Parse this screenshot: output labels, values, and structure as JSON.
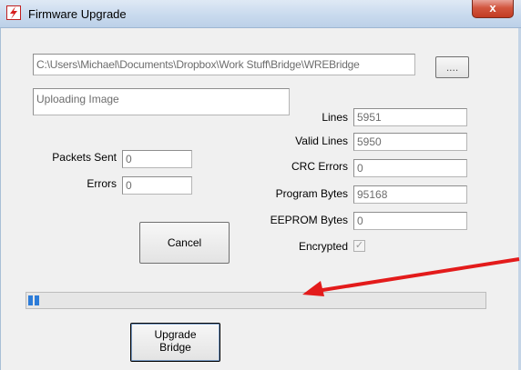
{
  "window": {
    "title": "Firmware Upgrade",
    "close_glyph": "x"
  },
  "path_field": {
    "value": "C:\\Users\\Michael\\Documents\\Dropbox\\Work Stuff\\Bridge\\WREBridge"
  },
  "browse_button": {
    "label": "...."
  },
  "status_field": {
    "value": "Uploading Image"
  },
  "counters_left": {
    "packets_sent": {
      "label": "Packets Sent",
      "value": "0"
    },
    "errors": {
      "label": "Errors",
      "value": "0"
    }
  },
  "counters_right": {
    "lines": {
      "label": "Lines",
      "value": "5951"
    },
    "valid_lines": {
      "label": "Valid Lines",
      "value": "5950"
    },
    "crc_errors": {
      "label": "CRC Errors",
      "value": "0"
    },
    "program_bytes": {
      "label": "Program Bytes",
      "value": "95168"
    },
    "eeprom_bytes": {
      "label": "EEPROM Bytes",
      "value": "0"
    },
    "encrypted": {
      "label": "Encrypted",
      "checked": true,
      "check_glyph": "✓"
    }
  },
  "cancel_button": {
    "label": "Cancel"
  },
  "upgrade_button": {
    "line1": "Upgrade",
    "line2": "Bridge"
  },
  "progress": {
    "fraction": 0.02,
    "color": "#2d7cd8"
  },
  "annotation": {
    "color": "#e31b1b",
    "icon": "arrow-annotation"
  }
}
